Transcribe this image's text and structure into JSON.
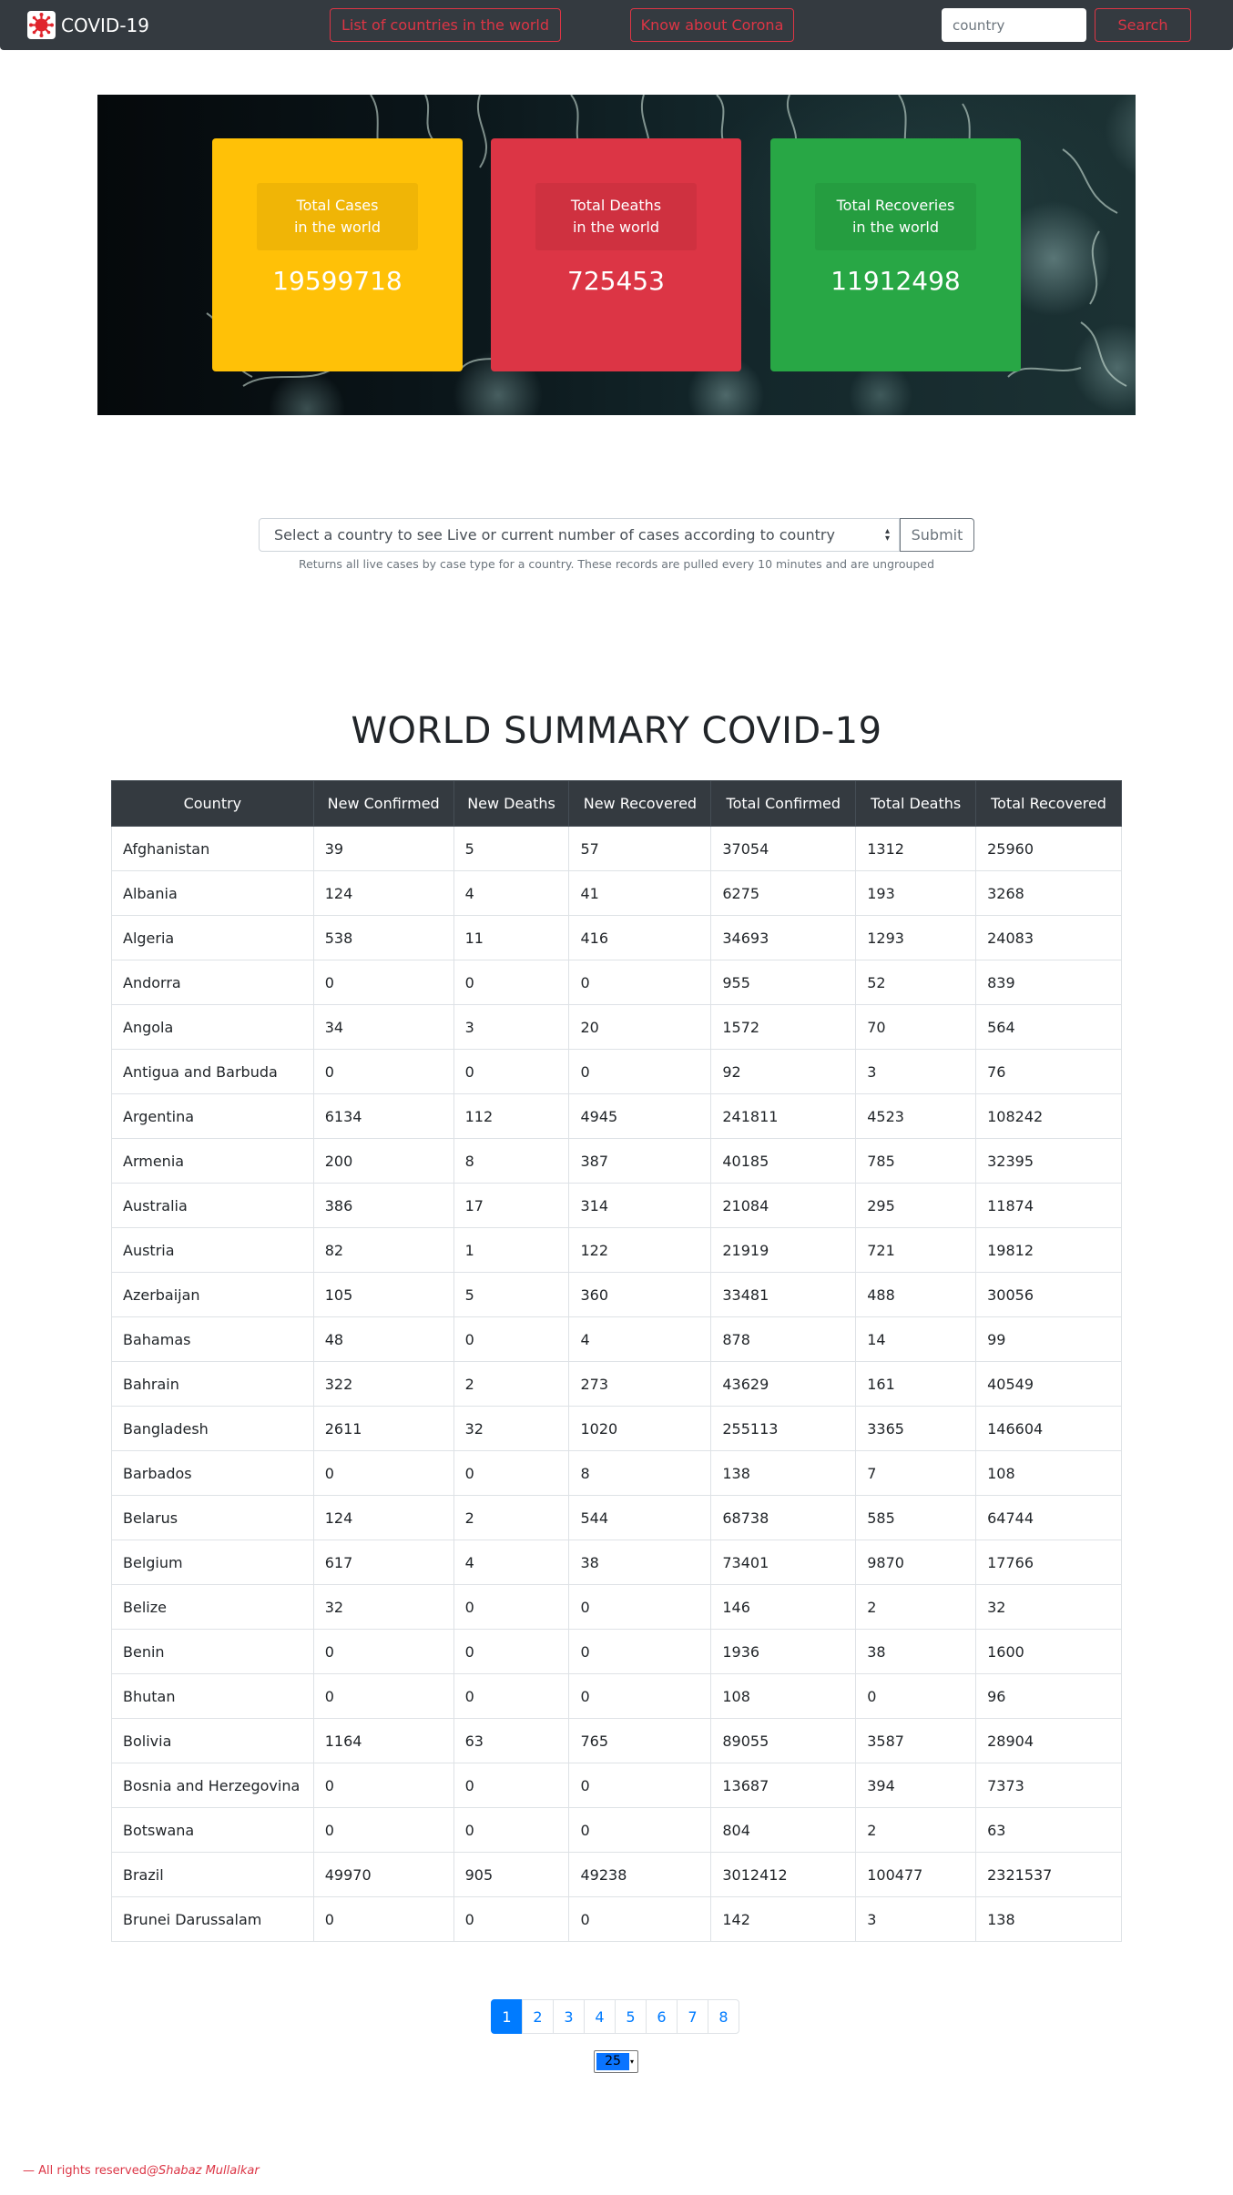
{
  "navbar": {
    "brand": "COVID-19",
    "list_countries": "List of countries in the world",
    "know_corona": "Know about Corona",
    "search_placeholder": "country",
    "search_button": "Search"
  },
  "hero": {
    "cases_line1": "Total Cases",
    "cases_line2": "in the world",
    "cases_value": "19599718",
    "deaths_line1": "Total Deaths",
    "deaths_line2": "in the world",
    "deaths_value": "725453",
    "recoveries_line1": "Total Recoveries",
    "recoveries_line2": "in the world",
    "recoveries_value": "11912498"
  },
  "country_form": {
    "select_value": "Select a country to see Live or current number of cases according to country",
    "submit": "Submit",
    "help": "Returns all live cases by case type for a country. These records are pulled every 10 minutes and are ungrouped"
  },
  "summary": {
    "title": "WORLD SUMMARY COVID-19",
    "columns": [
      "Country",
      "New Confirmed",
      "New Deaths",
      "New Recovered",
      "Total Confirmed",
      "Total Deaths",
      "Total Recovered"
    ],
    "rows": [
      [
        "Afghanistan",
        "39",
        "5",
        "57",
        "37054",
        "1312",
        "25960"
      ],
      [
        "Albania",
        "124",
        "4",
        "41",
        "6275",
        "193",
        "3268"
      ],
      [
        "Algeria",
        "538",
        "11",
        "416",
        "34693",
        "1293",
        "24083"
      ],
      [
        "Andorra",
        "0",
        "0",
        "0",
        "955",
        "52",
        "839"
      ],
      [
        "Angola",
        "34",
        "3",
        "20",
        "1572",
        "70",
        "564"
      ],
      [
        "Antigua and Barbuda",
        "0",
        "0",
        "0",
        "92",
        "3",
        "76"
      ],
      [
        "Argentina",
        "6134",
        "112",
        "4945",
        "241811",
        "4523",
        "108242"
      ],
      [
        "Armenia",
        "200",
        "8",
        "387",
        "40185",
        "785",
        "32395"
      ],
      [
        "Australia",
        "386",
        "17",
        "314",
        "21084",
        "295",
        "11874"
      ],
      [
        "Austria",
        "82",
        "1",
        "122",
        "21919",
        "721",
        "19812"
      ],
      [
        "Azerbaijan",
        "105",
        "5",
        "360",
        "33481",
        "488",
        "30056"
      ],
      [
        "Bahamas",
        "48",
        "0",
        "4",
        "878",
        "14",
        "99"
      ],
      [
        "Bahrain",
        "322",
        "2",
        "273",
        "43629",
        "161",
        "40549"
      ],
      [
        "Bangladesh",
        "2611",
        "32",
        "1020",
        "255113",
        "3365",
        "146604"
      ],
      [
        "Barbados",
        "0",
        "0",
        "8",
        "138",
        "7",
        "108"
      ],
      [
        "Belarus",
        "124",
        "2",
        "544",
        "68738",
        "585",
        "64744"
      ],
      [
        "Belgium",
        "617",
        "4",
        "38",
        "73401",
        "9870",
        "17766"
      ],
      [
        "Belize",
        "32",
        "0",
        "0",
        "146",
        "2",
        "32"
      ],
      [
        "Benin",
        "0",
        "0",
        "0",
        "1936",
        "38",
        "1600"
      ],
      [
        "Bhutan",
        "0",
        "0",
        "0",
        "108",
        "0",
        "96"
      ],
      [
        "Bolivia",
        "1164",
        "63",
        "765",
        "89055",
        "3587",
        "28904"
      ],
      [
        "Bosnia and Herzegovina",
        "0",
        "0",
        "0",
        "13687",
        "394",
        "7373"
      ],
      [
        "Botswana",
        "0",
        "0",
        "0",
        "804",
        "2",
        "63"
      ],
      [
        "Brazil",
        "49970",
        "905",
        "49238",
        "3012412",
        "100477",
        "2321537"
      ],
      [
        "Brunei Darussalam",
        "0",
        "0",
        "0",
        "142",
        "3",
        "138"
      ]
    ]
  },
  "pagination": {
    "pages": [
      "1",
      "2",
      "3",
      "4",
      "5",
      "6",
      "7",
      "8"
    ],
    "active_page": "1",
    "page_size": "25"
  },
  "footer": {
    "prefix": "— All rights reserved",
    "author": "@Shabaz Mullalkar"
  },
  "colors": {
    "navbar": "#343a40",
    "danger": "#dc3545",
    "warning": "#ffc107",
    "success": "#28a745",
    "primary": "#007bff"
  }
}
